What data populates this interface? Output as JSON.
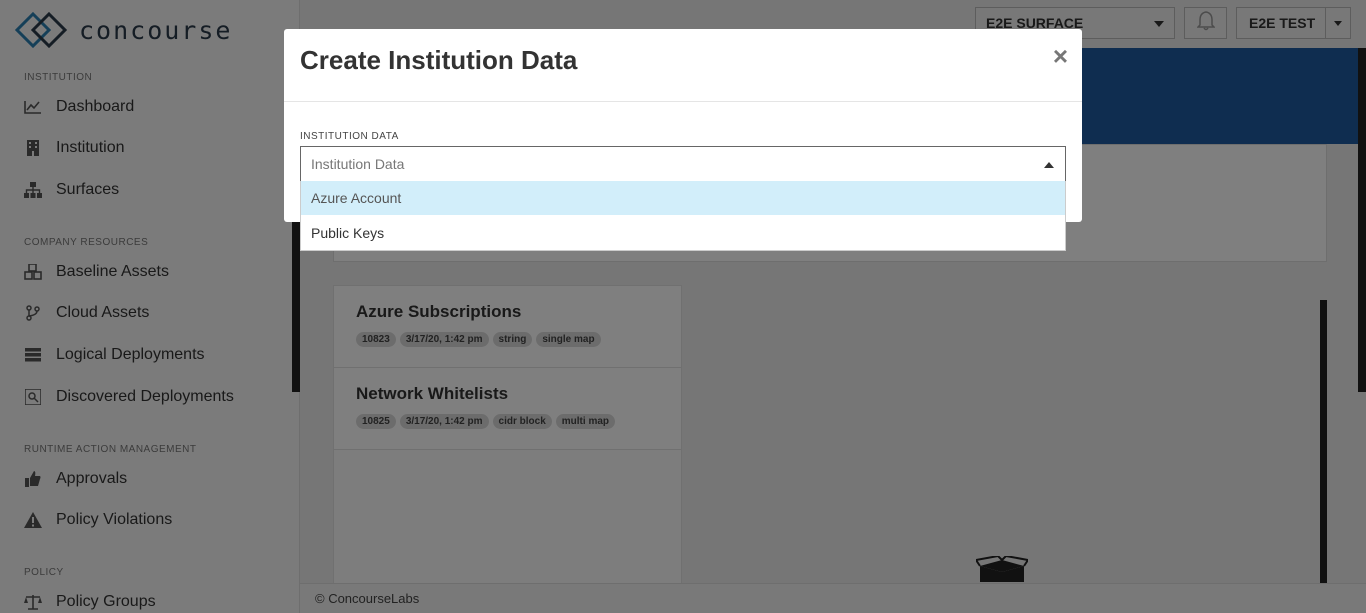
{
  "app": {
    "brand": "concourse"
  },
  "sidebar": {
    "sections": [
      {
        "heading": "INSTITUTION",
        "items": [
          {
            "label": "Dashboard",
            "icon": "chart-line-icon"
          },
          {
            "label": "Institution",
            "icon": "building-icon"
          },
          {
            "label": "Surfaces",
            "icon": "sitemap-icon"
          }
        ]
      },
      {
        "heading": "COMPANY RESOURCES",
        "items": [
          {
            "label": "Baseline Assets",
            "icon": "cubes-icon"
          },
          {
            "label": "Cloud Assets",
            "icon": "code-branch-icon"
          },
          {
            "label": "Logical Deployments",
            "icon": "server-icon"
          },
          {
            "label": "Discovered Deployments",
            "icon": "search-list-icon"
          }
        ]
      },
      {
        "heading": "RUNTIME ACTION MANAGEMENT",
        "items": [
          {
            "label": "Approvals",
            "icon": "thumbs-up-icon"
          },
          {
            "label": "Policy Violations",
            "icon": "warning-icon"
          }
        ]
      },
      {
        "heading": "POLICY",
        "items": [
          {
            "label": "Policy Groups",
            "icon": "balance-icon"
          }
        ]
      }
    ]
  },
  "topbar": {
    "surface_select": "E2E SURFACE",
    "user": "E2E TEST"
  },
  "list": {
    "items": [
      {
        "title": "Azure Subscriptions",
        "tags": [
          "10823",
          "3/17/20, 1:42 pm",
          "string",
          "single map"
        ]
      },
      {
        "title": "Network Whitelists",
        "tags": [
          "10825",
          "3/17/20, 1:42 pm",
          "cidr block",
          "multi map"
        ]
      }
    ]
  },
  "footer": {
    "text": "© ConcourseLabs"
  },
  "modal": {
    "title": "Create Institution Data",
    "close": "×",
    "field_label": "INSTITUTION DATA",
    "placeholder": "Institution Data",
    "options": [
      "Azure Account",
      "Public Keys"
    ],
    "active_option": 0
  },
  "colors": {
    "banner": "#1f5aa0",
    "option_highlight": "#d2eefa"
  }
}
